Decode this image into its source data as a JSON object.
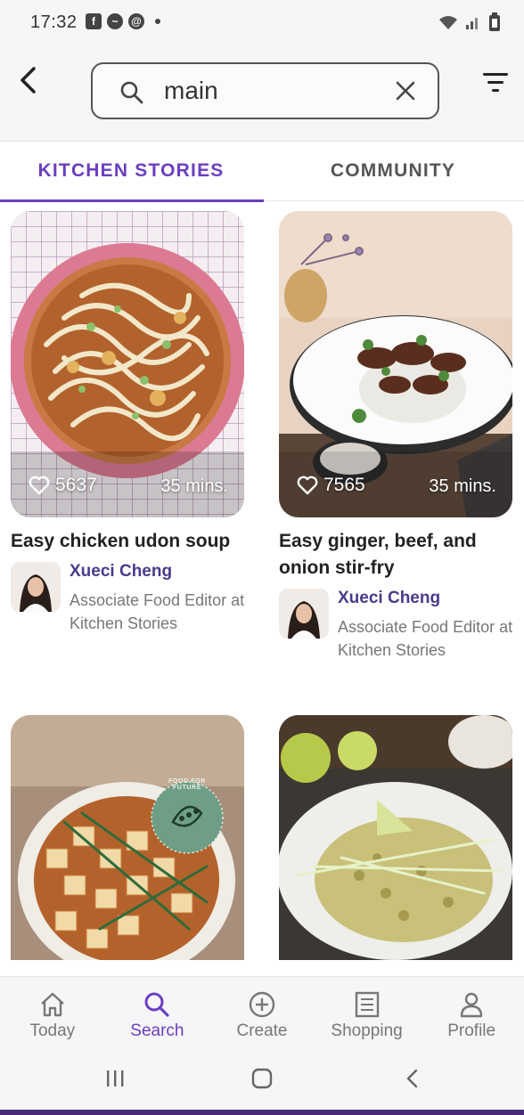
{
  "status_bar": {
    "time": "17:32"
  },
  "search": {
    "query": "main"
  },
  "tabs": [
    {
      "label": "KITCHEN STORIES",
      "active": true
    },
    {
      "label": "COMMUNITY",
      "active": false
    }
  ],
  "recipes": [
    {
      "title": "Easy chicken udon soup",
      "likes": "5637",
      "duration": "35 mins.",
      "author_name": "Xueci Cheng",
      "author_role": "Associate Food Editor at Kitchen Stories"
    },
    {
      "title": "Easy ginger, beef, and onion stir-fry",
      "likes": "7565",
      "duration": "35 mins.",
      "author_name": "Xueci Cheng",
      "author_role": "Associate Food Editor at Kitchen Stories"
    },
    {
      "badge_text": "FOOD FOR FUTURE"
    },
    {}
  ],
  "bottom_nav": [
    {
      "label": "Today",
      "icon": "home-icon"
    },
    {
      "label": "Search",
      "icon": "search-icon",
      "active": true
    },
    {
      "label": "Create",
      "icon": "plus-circle-icon"
    },
    {
      "label": "Shopping",
      "icon": "list-icon"
    },
    {
      "label": "Profile",
      "icon": "person-icon"
    }
  ],
  "colors": {
    "accent": "#6a3fc0",
    "author": "#4a3b8c"
  }
}
